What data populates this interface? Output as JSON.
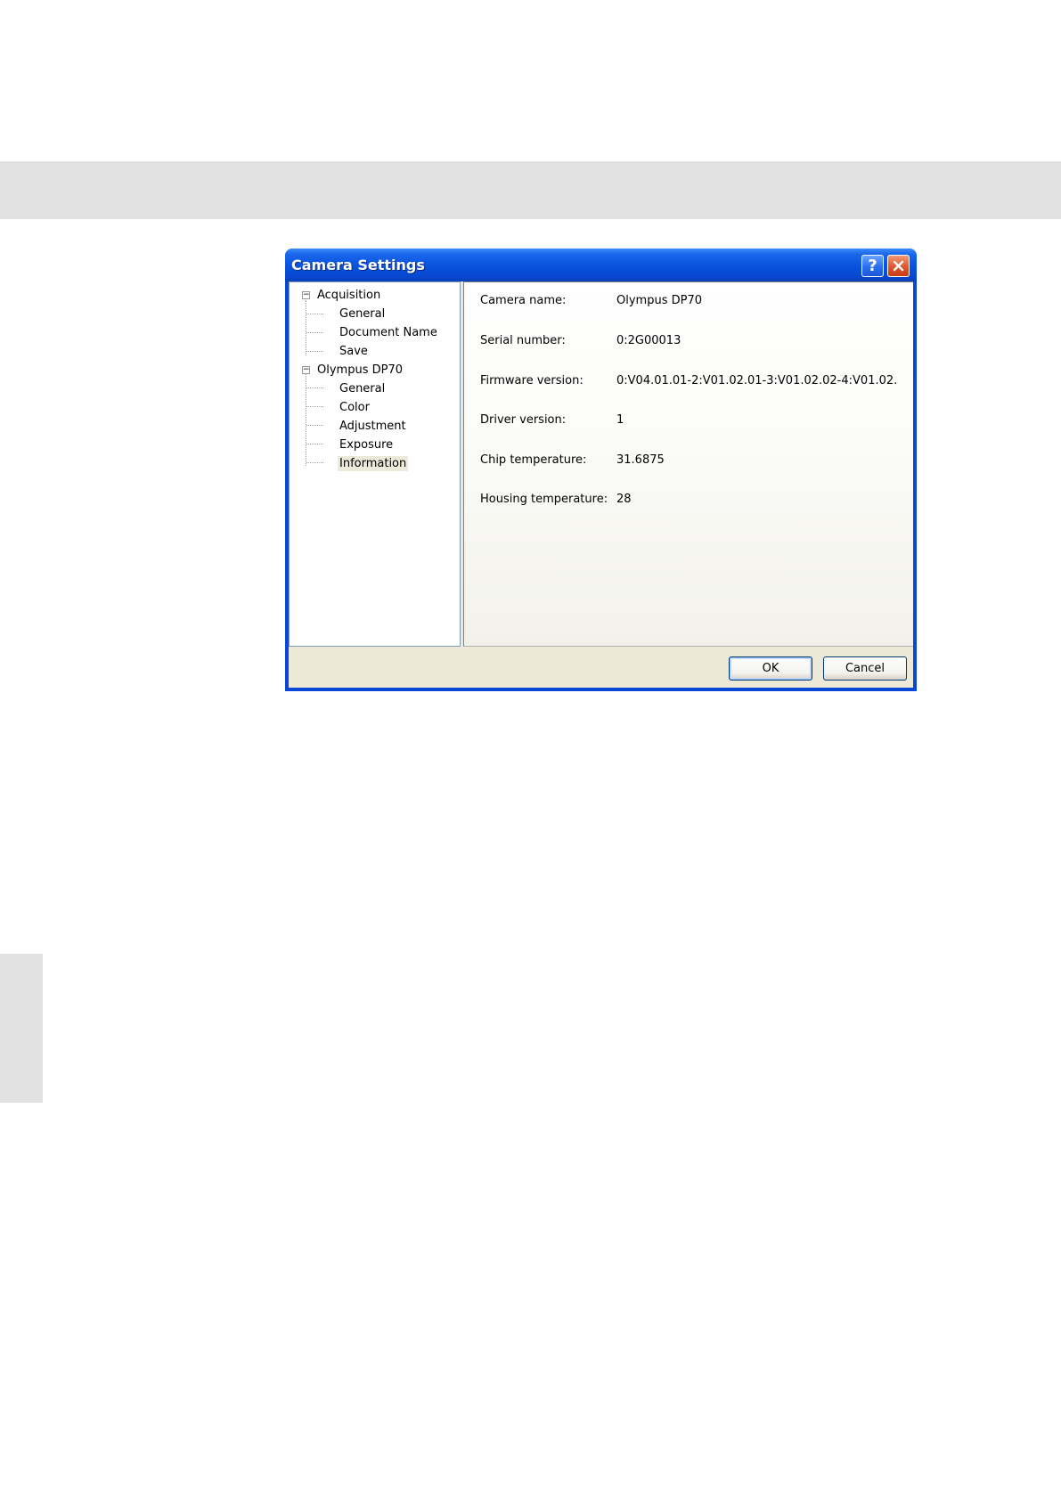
{
  "dialog": {
    "title": "Camera Settings",
    "help_glyph": "?",
    "close_glyph": "✕",
    "help_icon": "help-icon",
    "close_icon": "close-icon"
  },
  "tree": {
    "groups": [
      {
        "label": "Acquisition",
        "expander": "⊟",
        "children": [
          "General",
          "Document Name",
          "Save"
        ]
      },
      {
        "label": "Olympus DP70",
        "expander": "⊟",
        "children": [
          "General",
          "Color",
          "Adjustment",
          "Exposure",
          "Information"
        ]
      }
    ],
    "selected": "Information"
  },
  "info": {
    "rows": [
      {
        "label": "Camera name:",
        "value": "Olympus DP70"
      },
      {
        "label": "Serial number:",
        "value": "0:2G00013"
      },
      {
        "label": "Firmware version:",
        "value": "0:V04.01.01-2:V01.02.01-3:V01.02.02-4:V01.02."
      },
      {
        "label": "Driver version:",
        "value": "1"
      },
      {
        "label": "Chip temperature:",
        "value": "31.6875"
      },
      {
        "label": "Housing temperature:",
        "value": "28"
      }
    ]
  },
  "buttons": {
    "ok_label": "OK",
    "cancel_label": "Cancel"
  },
  "colors": {
    "titlebar": "#0a52dc",
    "dialog_face": "#ece9d8",
    "page_band": "#e1e1e1"
  }
}
